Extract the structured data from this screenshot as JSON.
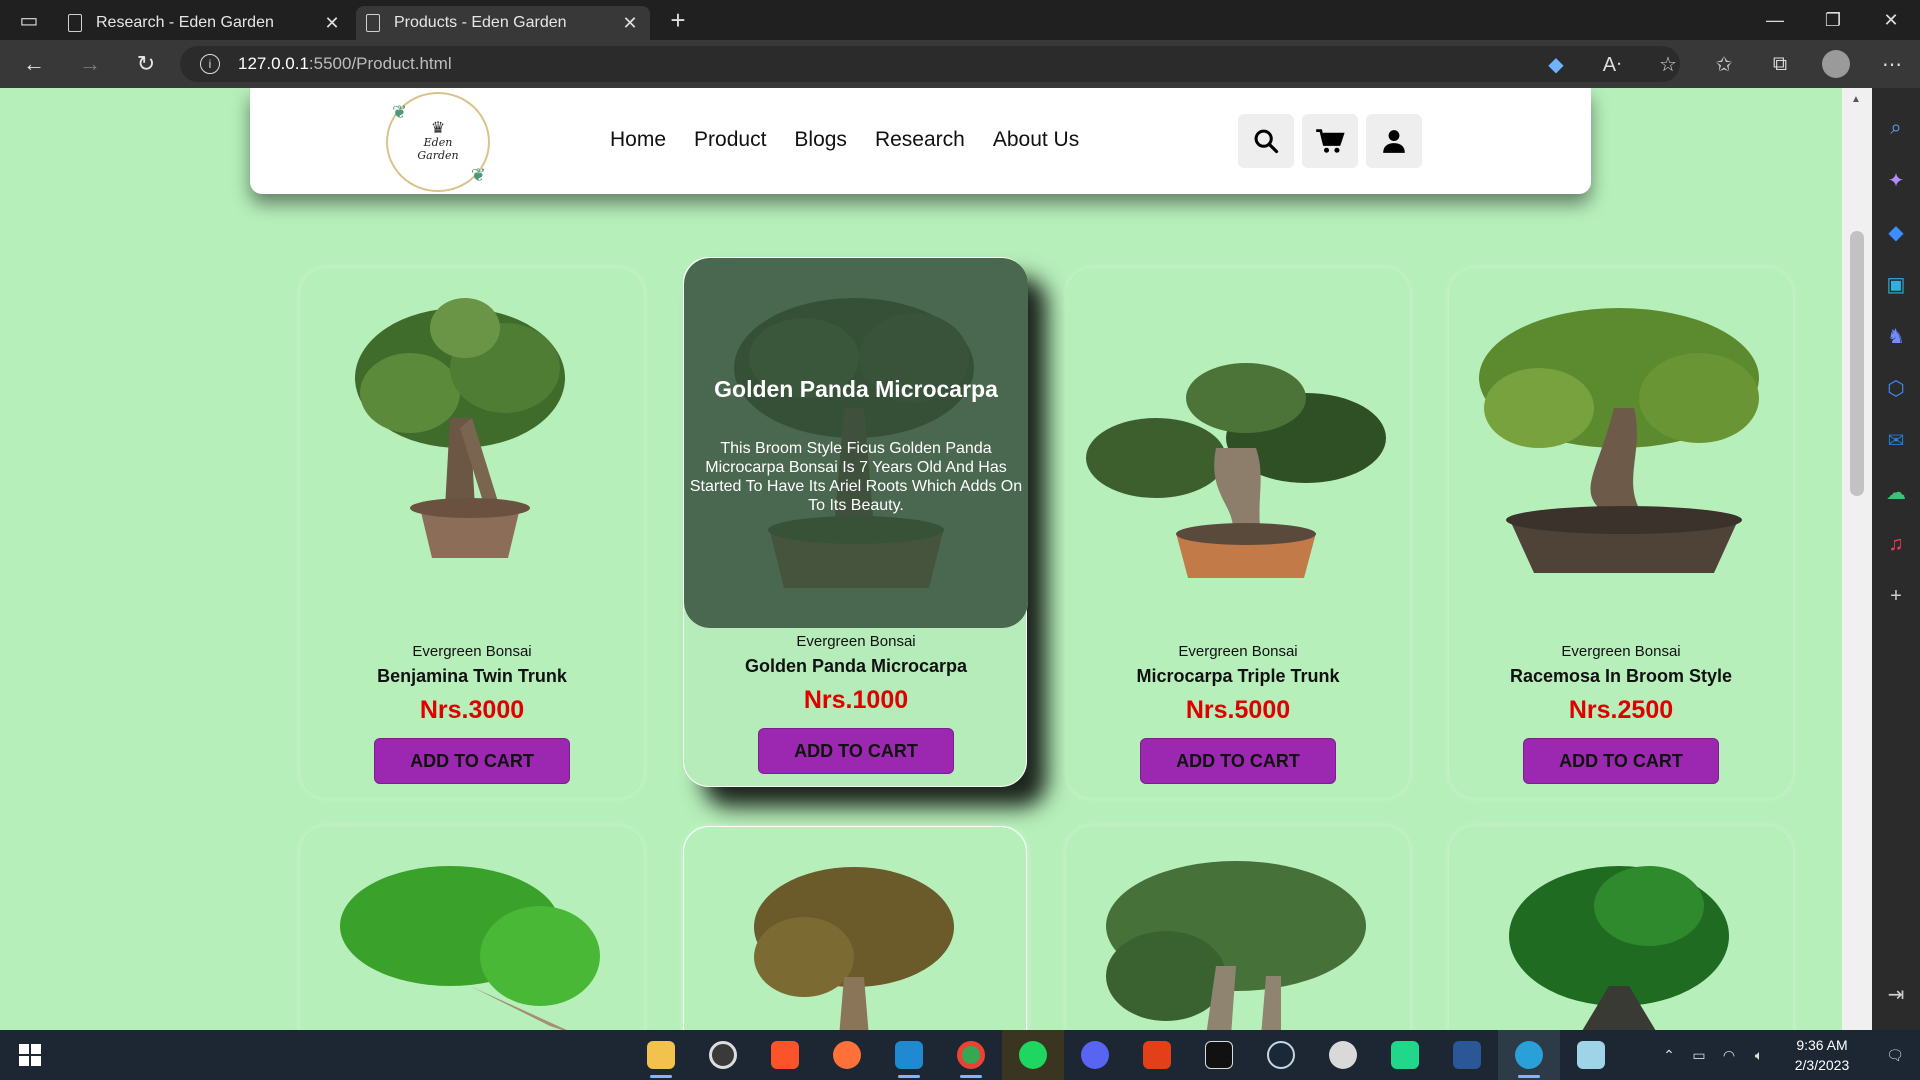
{
  "browser": {
    "tabs": [
      {
        "title": "Research - Eden Garden",
        "active": false
      },
      {
        "title": "Products - Eden Garden",
        "active": true
      }
    ],
    "url_host": "127.0.0.1",
    "url_path": ":5500/Product.html"
  },
  "site": {
    "logo_text_line1": "Eden",
    "logo_text_line2": "Garden",
    "nav": [
      "Home",
      "Product",
      "Blogs",
      "Research",
      "About Us"
    ]
  },
  "products": [
    {
      "category": "Evergreen Bonsai",
      "name": "Benjamina Twin Trunk",
      "price": "Nrs.3000",
      "button": "ADD TO CART"
    },
    {
      "category": "Evergreen Bonsai",
      "name": "Golden Panda Microcarpa",
      "price": "Nrs.1000",
      "button": "ADD TO CART",
      "overlay_title": "Golden Panda Microcarpa",
      "overlay_desc": "This Broom Style Ficus Golden Panda Microcarpa Bonsai Is 7 Years Old And Has Started To Have Its Ariel Roots Which Adds On To Its Beauty."
    },
    {
      "category": "Evergreen Bonsai",
      "name": "Microcarpa Triple Trunk",
      "price": "Nrs.5000",
      "button": "ADD TO CART"
    },
    {
      "category": "Evergreen Bonsai",
      "name": "Racemosa In Broom Style",
      "price": "Nrs.2500",
      "button": "ADD TO CART"
    }
  ],
  "taskbar": {
    "time": "9:36 AM",
    "date": "2/3/2023"
  },
  "colors": {
    "page_bg": "#b7efbb",
    "button": "#9c27b0",
    "price": "#e00000"
  }
}
